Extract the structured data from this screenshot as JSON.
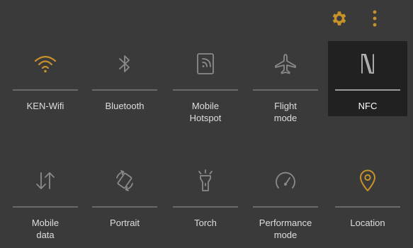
{
  "colors": {
    "background": "#3a3a3a",
    "active_tile": "#212121",
    "accent": "#c8922a",
    "inactive_icon": "#8a8a8a",
    "label": "#dedede"
  },
  "top_actions": [
    {
      "icon": "gear-icon",
      "color": "#c8922a"
    },
    {
      "icon": "more-vertical-icon",
      "color": "#c8922a"
    }
  ],
  "tiles": [
    {
      "label": "KEN-Wifi",
      "icon": "wifi-icon",
      "active": false,
      "icon_color": "#c8922a"
    },
    {
      "label": "Bluetooth",
      "icon": "bluetooth-icon",
      "active": false
    },
    {
      "label": "Mobile\nHotspot",
      "icon": "hotspot-icon",
      "active": false
    },
    {
      "label": "Flight\nmode",
      "icon": "airplane-icon",
      "active": false
    },
    {
      "label": "NFC",
      "icon": "nfc-icon",
      "active": true
    },
    {
      "label": "Mobile\ndata",
      "icon": "mobile-data-icon",
      "active": false
    },
    {
      "label": "Portrait",
      "icon": "rotate-icon",
      "active": false
    },
    {
      "label": "Torch",
      "icon": "torch-icon",
      "active": false
    },
    {
      "label": "Performance\nmode",
      "icon": "speedometer-icon",
      "active": false
    },
    {
      "label": "Location",
      "icon": "location-pin-icon",
      "active": false,
      "icon_color": "#c8922a"
    }
  ]
}
